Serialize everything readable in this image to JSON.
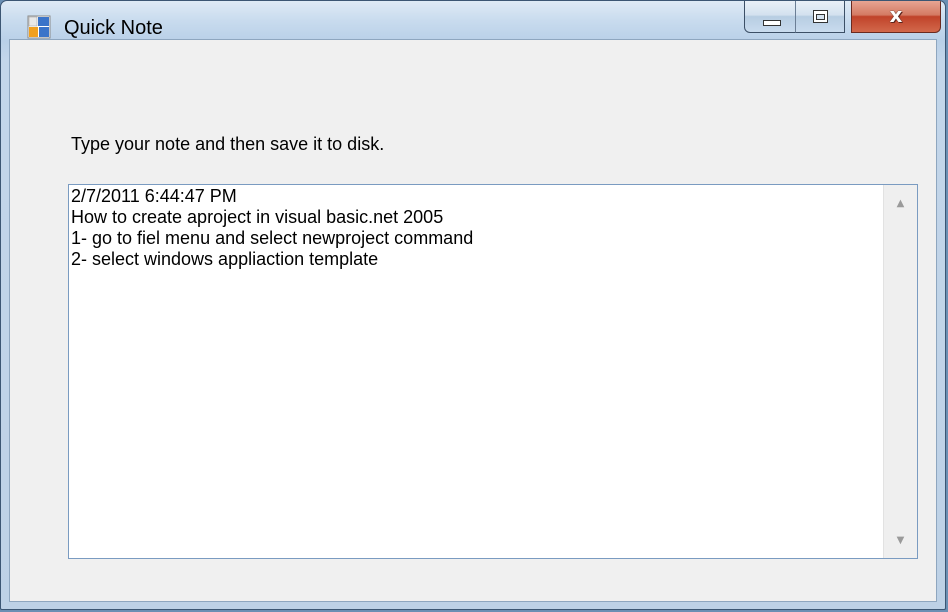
{
  "window": {
    "title": "Quick Note",
    "icon": "app-window-icon",
    "controls": {
      "minimize_icon": "minimize-icon",
      "maximize_icon": "maximize-icon",
      "close_icon": "close-icon",
      "close_glyph": "x"
    }
  },
  "form": {
    "prompt": "Type your note and then save it to disk.",
    "note_text": "2/7/2011 6:44:47 PM\nHow to create aproject in visual basic.net 2005\n1- go to fiel menu and select newproject command\n2- select windows appliaction template",
    "scroll_up_icon": "scroll-up-arrow-icon",
    "scroll_down_icon": "scroll-down-arrow-icon"
  },
  "colors": {
    "close_button": "#c0432a",
    "client_background": "#f0f0f0",
    "textbox_border": "#7a9bc1"
  }
}
